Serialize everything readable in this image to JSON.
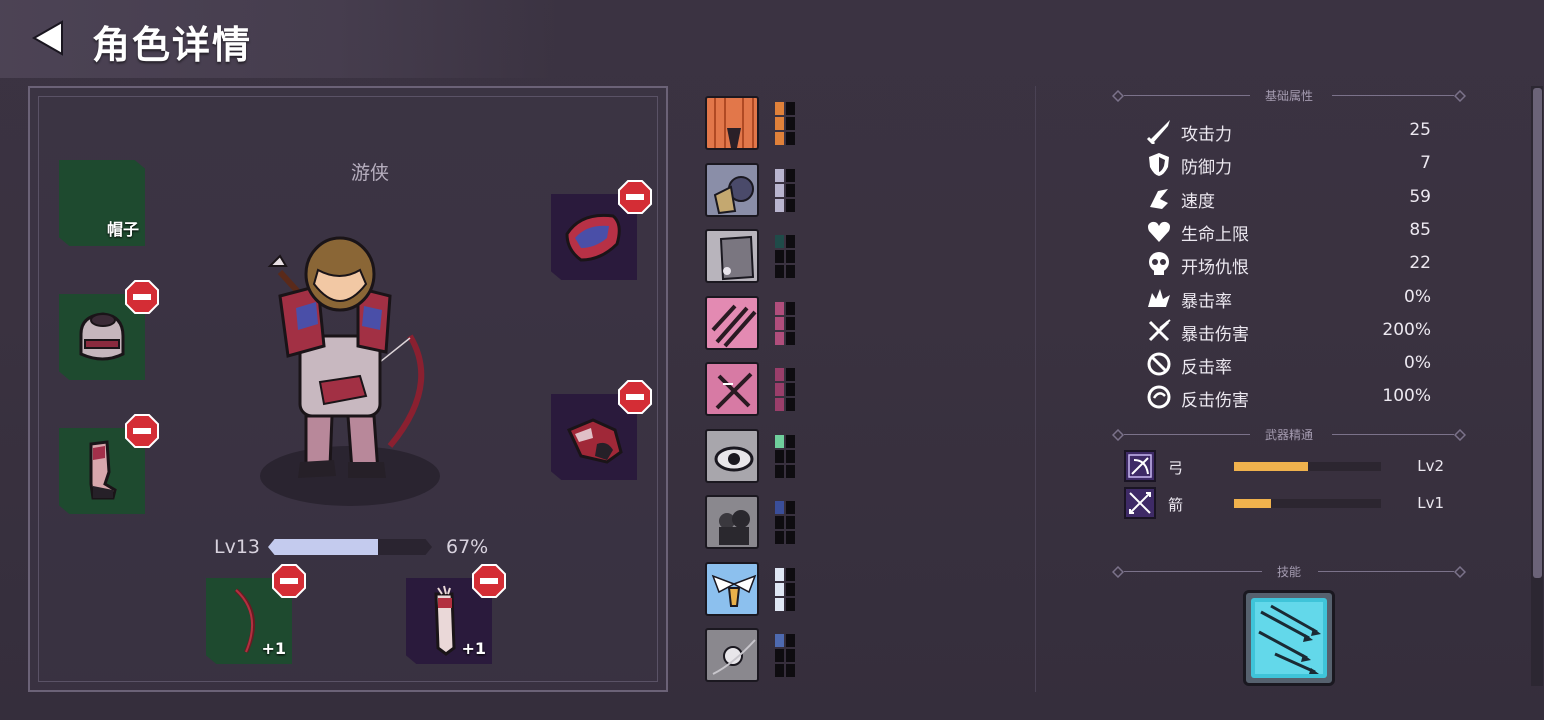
{
  "header": {
    "title": "角色详情"
  },
  "character": {
    "class_name": "游侠",
    "level_label": "Lv13",
    "xp_percent": 67,
    "xp_percent_label": "67%"
  },
  "equipment": {
    "hat": {
      "label": "帽子",
      "empty": true
    },
    "weapon_main": {
      "bonus": "+1"
    },
    "weapon_off": {
      "bonus": "+1"
    }
  },
  "skills_column": [
    {
      "name": "flame-rain-skill",
      "color": "#e0813a",
      "filled": 3
    },
    {
      "name": "warrior-skill",
      "color": "#b9b5cf",
      "filled": 3
    },
    {
      "name": "stone-skill",
      "color": "#1f4b49",
      "filled": 1
    },
    {
      "name": "slash-skill",
      "color": "#b04e7c",
      "filled": 3
    },
    {
      "name": "cross-slash-skill",
      "color": "#9a3e6a",
      "filled": 3
    },
    {
      "name": "eye-skill",
      "color": "#6fcf9c",
      "filled": 1
    },
    {
      "name": "shadow-skill",
      "color": "#3a4e9a",
      "filled": 1
    },
    {
      "name": "wings-skill",
      "color": "#dfe7f4",
      "filled": 3
    },
    {
      "name": "orb-skill",
      "color": "#4e6ab0",
      "filled": 1
    }
  ],
  "stats": {
    "section_title": "基础属性",
    "rows": [
      {
        "icon": "sword-icon",
        "label": "攻击力",
        "value": "25"
      },
      {
        "icon": "shield-icon",
        "label": "防御力",
        "value": "7"
      },
      {
        "icon": "boot-icon",
        "label": "速度",
        "value": "59"
      },
      {
        "icon": "heart-icon",
        "label": "生命上限",
        "value": "85"
      },
      {
        "icon": "skull-icon",
        "label": "开场仇恨",
        "value": "22"
      },
      {
        "icon": "crit-icon",
        "label": "暴击率",
        "value": "0%"
      },
      {
        "icon": "crit-damage-icon",
        "label": "暴击伤害",
        "value": "200%"
      },
      {
        "icon": "counter-icon",
        "label": "反击率",
        "value": "0%"
      },
      {
        "icon": "counter-damage-icon",
        "label": "反击伤害",
        "value": "100%"
      }
    ]
  },
  "mastery": {
    "section_title": "武器精通",
    "rows": [
      {
        "icon": "bow-icon",
        "label": "弓",
        "progress": 0.5,
        "level": "Lv2"
      },
      {
        "icon": "arrow-icon",
        "label": "箭",
        "progress": 0.25,
        "level": "Lv1"
      }
    ]
  },
  "skill_section": {
    "section_title": "技能",
    "icon": "arrow-volley-icon"
  },
  "colors": {
    "accent": "#f0b24d",
    "slot_green": "#1e4a2f",
    "slot_purple": "#2a1a3c",
    "remove_red": "#d42d35"
  }
}
